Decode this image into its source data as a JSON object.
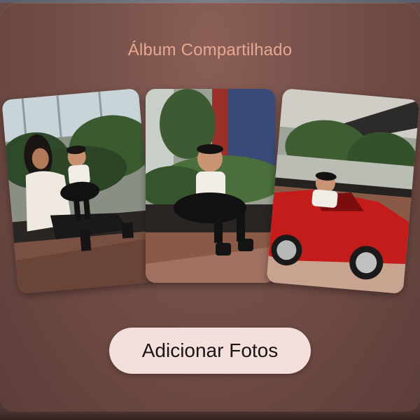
{
  "album": {
    "title": "Álbum Compartilhado",
    "add_button_label": "Adicionar Fotos"
  },
  "photos": [
    {
      "icon": "photo-mother-and-baby-in-garden"
    },
    {
      "icon": "photo-baby-sitting-on-planter"
    },
    {
      "icon": "photo-baby-in-red-toy-car"
    }
  ],
  "colors": {
    "title": "#e8a890",
    "button_bg": "#f3dfdc",
    "button_text": "#1a1414",
    "card_bg": "#78524b"
  }
}
